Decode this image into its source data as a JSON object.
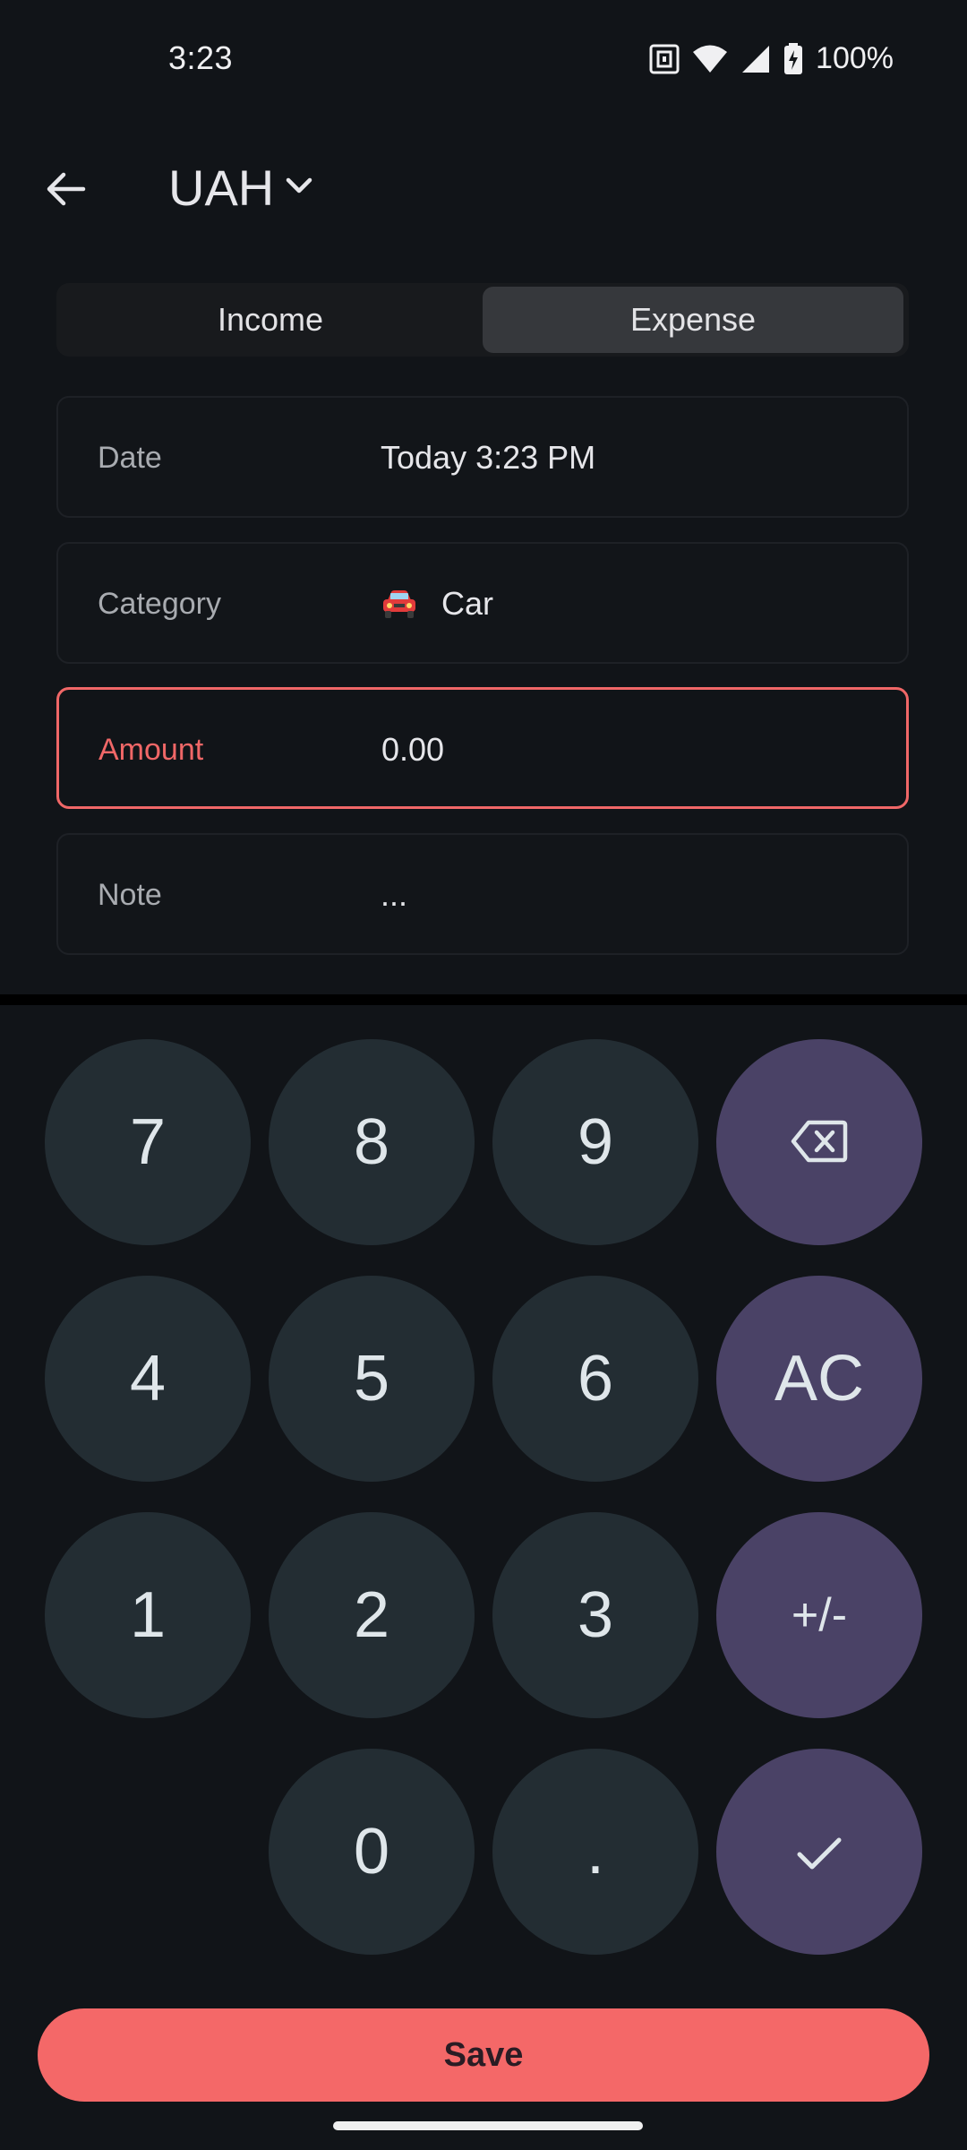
{
  "status_bar": {
    "time": "3:23",
    "battery": "100%",
    "icons": [
      "nfc-icon",
      "wifi-icon",
      "signal-icon",
      "battery-charging-icon"
    ]
  },
  "header": {
    "back_icon": "arrow-left-icon",
    "currency": "UAH",
    "currency_dropdown_icon": "chevron-down-icon"
  },
  "type_toggle": {
    "options": [
      "Income",
      "Expense"
    ],
    "selected": "Expense"
  },
  "form": {
    "date": {
      "label": "Date",
      "value": "Today 3:23 PM"
    },
    "category": {
      "label": "Category",
      "icon": "car-emoji",
      "value": "Car"
    },
    "amount": {
      "label": "Amount",
      "value": "0.00"
    },
    "note": {
      "label": "Note",
      "placeholder": "..."
    }
  },
  "keypad": {
    "keys": {
      "k7": "7",
      "k8": "8",
      "k9": "9",
      "k4": "4",
      "k5": "5",
      "k6": "6",
      "k1": "1",
      "k2": "2",
      "k3": "3",
      "k0": "0",
      "dot": ".",
      "clear": "AC",
      "sign": "+/-"
    },
    "backspace_icon": "backspace-icon",
    "confirm_icon": "check-icon"
  },
  "actions": {
    "save": "Save"
  },
  "colors": {
    "background": "#111418",
    "accent": "#f46868",
    "key": "#232d33",
    "operator_key": "#4a4266",
    "selected_segment": "#36383c"
  }
}
